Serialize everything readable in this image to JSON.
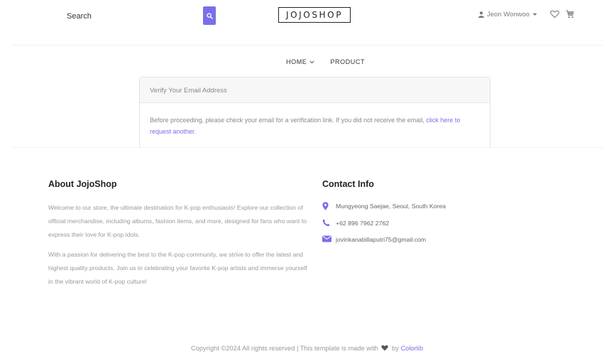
{
  "header": {
    "search_label": "Search",
    "logo_text": "JOJOSHOP",
    "user_name": "Jeon Wonwoo"
  },
  "nav": {
    "items": [
      {
        "label": "HOME",
        "has_dropdown": true
      },
      {
        "label": "PRODUCT",
        "has_dropdown": false
      }
    ]
  },
  "verify_card": {
    "title": "Verify Your Email Address",
    "body_text": "Before proceeding, please check your email for a verification link. If you did not receive the email,",
    "link_text": "click here to request another",
    "link_suffix": "."
  },
  "about": {
    "title": "About JojoShop",
    "paragraphs": [
      "Welcome to our store, the ultimate destination for K-pop enthusiasts! Explore our collection of official merchandise, including albums, fashion items, and more, designed for fans who want to express their love for K-pop idols.",
      "With a passion for delivering the best to the K-pop community, we strive to offer the latest and highest quality products. Join us in celebrating your favorite K-pop artists and immerse yourself in the vibrant world of K-pop culture!"
    ]
  },
  "contact": {
    "title": "Contact Info",
    "address": "Mungyeong Saejae, Seoul, South Korea",
    "phone": "+62 896 7962 2762",
    "email": "jovinkanabillaputri75@gmail.com"
  },
  "footer": {
    "copyright_prefix": "Copyright ©2024 All rights reserved | This template is made with",
    "copyright_by": "by",
    "credit_link": "Colorlib"
  },
  "icons": {
    "search": "search-icon",
    "user": "user-icon",
    "heart": "heart-icon",
    "cart": "cart-icon",
    "map_marker": "map-marker-icon",
    "phone": "phone-icon",
    "envelope": "envelope-icon"
  },
  "colors": {
    "accent": "#7a6fe8",
    "heading": "#222222",
    "body_text": "#999999"
  }
}
